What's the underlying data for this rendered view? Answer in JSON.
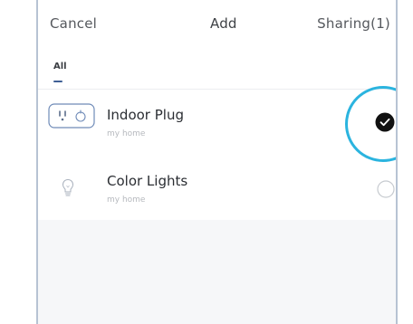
{
  "header": {
    "cancel_label": "Cancel",
    "title": "Add",
    "sharing_label": "Sharing(1)"
  },
  "tabs": [
    {
      "label": "All",
      "selected": true
    }
  ],
  "devices": [
    {
      "name": "Indoor Plug",
      "location": "my home",
      "icon": "smart-plug-icon",
      "selected": true
    },
    {
      "name": "Color Lights",
      "location": "my home",
      "icon": "light-bulb-icon",
      "selected": false
    }
  ],
  "colors": {
    "highlight_ring": "#2bb4df",
    "selected_check": "#111111",
    "tab_underline": "#3f5f95"
  }
}
